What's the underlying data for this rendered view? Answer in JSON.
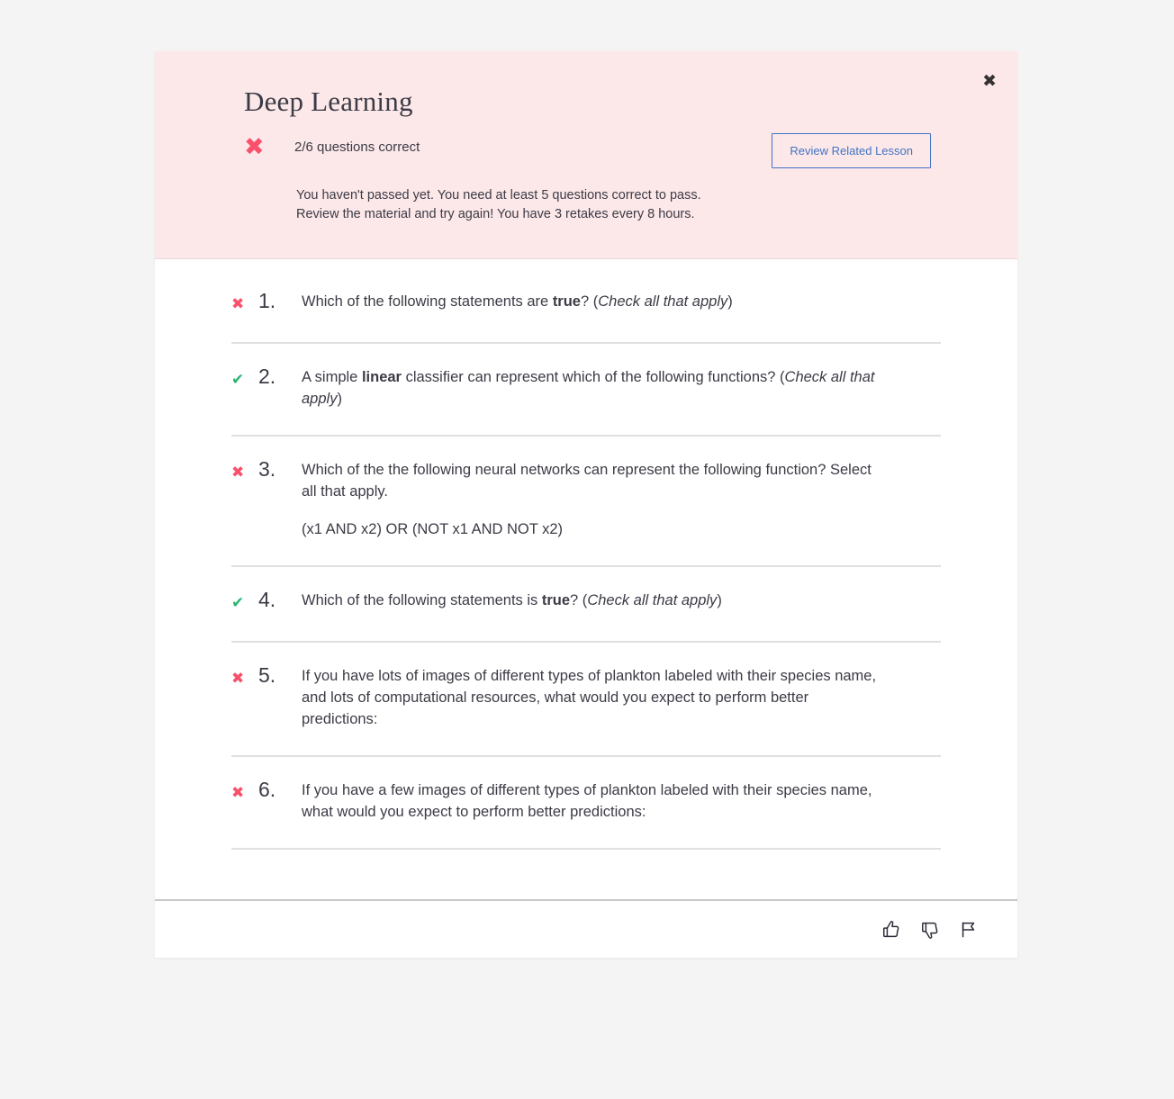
{
  "page": {
    "background_color": "#f4f4f4"
  },
  "modal": {
    "header": {
      "title": "Deep Learning",
      "close_label": "✖",
      "close_icon": "close-icon",
      "result_icon": "x-mark-icon",
      "result_icon_color": "#f9506b",
      "score_text": "2/6 questions correct",
      "review_button_label": "Review Related Lesson",
      "review_button_color": "#3f73c4",
      "status_line_1": "You haven't passed yet. You need at least 5 questions correct to pass.",
      "status_line_2": "Review the material and try again! You have 3 retakes every 8 hours.",
      "background_color": "#fde8e9"
    },
    "questions": [
      {
        "number": "1.",
        "status": "incorrect",
        "mark": "✖",
        "mark_color": "#f9506b",
        "segments": [
          [
            {
              "text": "Which of the following statements are ",
              "style": "normal"
            },
            {
              "text": "true",
              "style": "bold"
            },
            {
              "text": "? (",
              "style": "normal"
            },
            {
              "text": "Check all that apply",
              "style": "italic"
            },
            {
              "text": ")",
              "style": "normal"
            }
          ]
        ]
      },
      {
        "number": "2.",
        "status": "correct",
        "mark": "✔",
        "mark_color": "#2ab573",
        "segments": [
          [
            {
              "text": "A simple ",
              "style": "normal"
            },
            {
              "text": "linear",
              "style": "bold"
            },
            {
              "text": " classifier can represent which of the following functions? (",
              "style": "normal"
            },
            {
              "text": "Check all that apply",
              "style": "italic"
            },
            {
              "text": ")",
              "style": "normal"
            }
          ]
        ]
      },
      {
        "number": "3.",
        "status": "incorrect",
        "mark": "✖",
        "mark_color": "#f9506b",
        "segments": [
          [
            {
              "text": "Which of the the following neural networks can represent the following function? Select all that apply.",
              "style": "normal"
            }
          ],
          [
            {
              "text": "(x1 AND x2) OR (NOT x1 AND NOT x2)",
              "style": "normal"
            }
          ]
        ]
      },
      {
        "number": "4.",
        "status": "correct",
        "mark": "✔",
        "mark_color": "#2ab573",
        "segments": [
          [
            {
              "text": "Which of the following statements is ",
              "style": "normal"
            },
            {
              "text": "true",
              "style": "bold"
            },
            {
              "text": "? (",
              "style": "normal"
            },
            {
              "text": "Check all that apply",
              "style": "italic"
            },
            {
              "text": ")",
              "style": "normal"
            }
          ]
        ]
      },
      {
        "number": "5.",
        "status": "incorrect",
        "mark": "✖",
        "mark_color": "#f9506b",
        "segments": [
          [
            {
              "text": "If you have lots of images of different types of plankton labeled with their species name, and lots of computational resources, what would you expect to perform better predictions:",
              "style": "normal"
            }
          ]
        ]
      },
      {
        "number": "6.",
        "status": "incorrect",
        "mark": "✖",
        "mark_color": "#f9506b",
        "segments": [
          [
            {
              "text": "If you have a few images of different types of plankton labeled with their species name, what would you expect to perform better predictions:",
              "style": "normal"
            }
          ]
        ]
      }
    ],
    "footer": {
      "icons": [
        {
          "name": "thumbs-up-icon",
          "label": "Helpful"
        },
        {
          "name": "thumbs-down-icon",
          "label": "Not helpful"
        },
        {
          "name": "flag-icon",
          "label": "Report"
        }
      ]
    }
  }
}
